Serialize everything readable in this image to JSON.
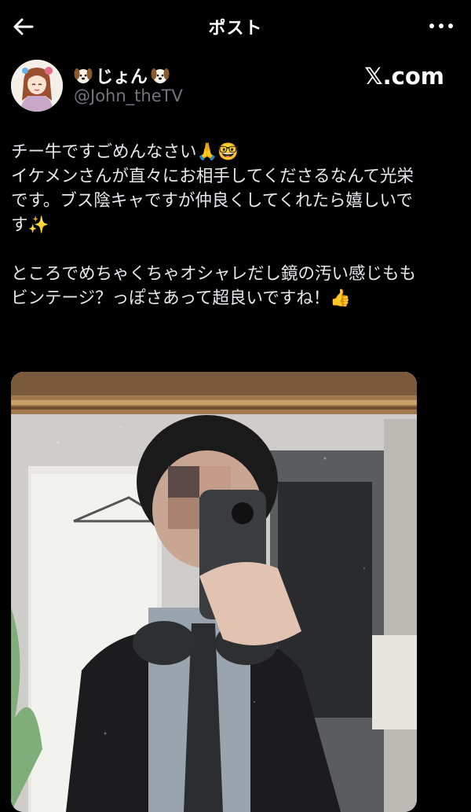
{
  "header": {
    "title": "ポスト",
    "back_icon": "arrow-left-icon",
    "more_icon": "more-horizontal-icon"
  },
  "author": {
    "display_name": "じょん",
    "name_emoji_icon": "dog-face-icon",
    "handle": "@John_theTV",
    "avatar_icon": "anime-avatar"
  },
  "brand": {
    "logo_text": "𝕏.com"
  },
  "post": {
    "lines": [
      "チー牛ですごめんなさい🙏🤓",
      "イケメンさんが直々にお相手してくださるなんて光栄",
      "です。ブス陰キャですが仲良くしてくれたら嬉しいで",
      "す✨",
      "",
      "ところでめちゃくちゃオシャレだし鏡の汚い感じもも",
      "ビンテージ？っぽさあって超良いですね！👍"
    ],
    "image_icon": "mirror-selfie-photo"
  },
  "colors": {
    "background": "#000000",
    "text": "#e7e9ea",
    "secondary_text": "#71767b"
  }
}
